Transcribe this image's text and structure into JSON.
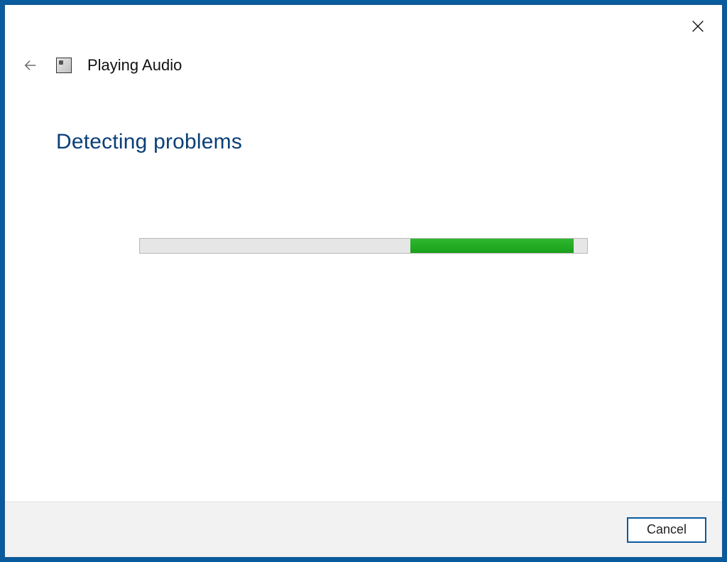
{
  "window": {
    "title": "Playing Audio"
  },
  "content": {
    "heading": "Detecting problems"
  },
  "progress": {
    "indeterminate_offset_pct": 60.5,
    "indeterminate_width_pct": 36.5
  },
  "footer": {
    "cancel_label": "Cancel"
  }
}
